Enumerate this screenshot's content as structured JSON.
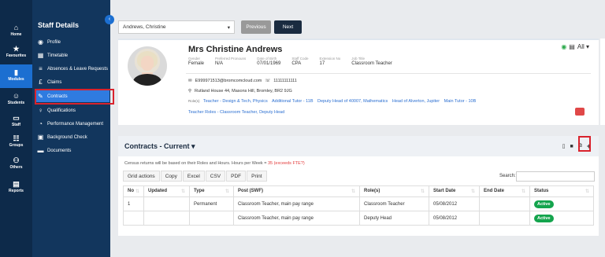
{
  "rail": [
    {
      "icon": "⌂",
      "label": "Home"
    },
    {
      "icon": "★",
      "label": "Favourites"
    },
    {
      "icon": "▮",
      "label": "Modules"
    },
    {
      "icon": "☺",
      "label": "Students"
    },
    {
      "icon": "▭",
      "label": "Staff"
    },
    {
      "icon": "☷",
      "label": "Groups"
    },
    {
      "icon": "⚇",
      "label": "Others"
    },
    {
      "icon": "▤",
      "label": "Reports"
    }
  ],
  "sidebar": {
    "title": "Staff Details",
    "items": [
      {
        "icon": "◉",
        "label": "Profile"
      },
      {
        "icon": "▦",
        "label": "Timetable"
      },
      {
        "icon": "≡",
        "label": "Absences & Leave Requests"
      },
      {
        "icon": "£",
        "label": "Claims"
      },
      {
        "icon": "✎",
        "label": "Contracts"
      },
      {
        "icon": "♀",
        "label": "Qualifications"
      },
      {
        "icon": "◔",
        "label": "Performance Management"
      },
      {
        "icon": "▣",
        "label": "Background Check"
      },
      {
        "icon": "▬",
        "label": "Documents"
      }
    ]
  },
  "topbar": {
    "staff_select": "Andrews, Christine",
    "prev_label": "Previous",
    "next_label": "Next"
  },
  "profile": {
    "name": "Mrs Christine Andrews",
    "facts": [
      {
        "k": "Gender",
        "v": "Female"
      },
      {
        "k": "Preferred Pronouns",
        "v": "N/A"
      },
      {
        "k": "Date of Birth",
        "v": "07/01/1969"
      },
      {
        "k": "Staff Code",
        "v": "CPA"
      },
      {
        "k": "Extension No",
        "v": "17"
      },
      {
        "k": "Job Title",
        "v": "Classroom Teacher"
      }
    ],
    "email": "E999971513@bromcomcloud.com",
    "phone": "11111111111",
    "address": "Rutland House 44, Masons Hill, Bromley, BR2 9JG",
    "roles_label": "Role(s)",
    "roles": [
      "Teacher - Design & Tech, Physics",
      "Additional Tutor - 11B",
      "Deputy Head of 40007, Mathematics",
      "Head of Alverton, Jupiter",
      "Main Tutor - 10B"
    ],
    "teacher_roles": "Teacher Roles - Classroom Teacher, Deputy Head",
    "all_label": "All"
  },
  "contracts": {
    "title": "Contracts - Current",
    "census_text": "Census returns will be based on their Roles and Hours. Hours per Week = ",
    "census_warn": "35 (exceeds FTE?)",
    "grid_buttons": [
      "Grid actions",
      "Copy",
      "Excel",
      "CSV",
      "PDF",
      "Print"
    ],
    "search_label": "Search:",
    "columns": [
      "No",
      "Updated",
      "Type",
      "Post (SWF)",
      "Role(s)",
      "Start Date",
      "End Date",
      "Status"
    ],
    "rows": [
      {
        "no": "1",
        "updated": "",
        "type": "Permanent",
        "post": "Classroom Teacher, main pay range",
        "role": "Classroom Teacher",
        "start": "05/08/2012",
        "end": "",
        "status": "Active"
      },
      {
        "no": "",
        "updated": "",
        "type": "",
        "post": "Classroom Teacher, main pay range",
        "role": "Deputy Head",
        "start": "05/08/2012",
        "end": "",
        "status": "Active"
      }
    ]
  },
  "colors": {
    "accent": "#2f7be0",
    "nav": "#12365d",
    "highlight": "#d9232d",
    "active_badge": "#14a44d"
  }
}
